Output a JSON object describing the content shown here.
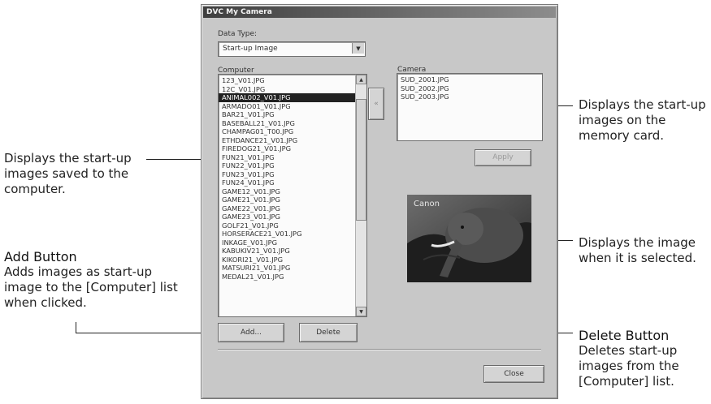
{
  "dialog": {
    "title": "DVC My Camera",
    "data_type_label": "Data Type:",
    "data_type_value": "Start-up Image",
    "computer_label": "Computer",
    "camera_label": "Camera",
    "computer_items": [
      "123_V01.JPG",
      "12C_V01.JPG",
      "ANIMAL002_V01.JPG",
      "ARMADO01_V01.JPG",
      "BAR21_V01.JPG",
      "BASEBALL21_V01.JPG",
      "CHAMPAG01_T00.JPG",
      "ETHDANCE21_V01.JPG",
      "FIREDOG21_V01.JPG",
      "FUN21_V01.JPG",
      "FUN22_V01.JPG",
      "FUN23_V01.JPG",
      "FUN24_V01.JPG",
      "GAME12_V01.JPG",
      "GAME21_V01.JPG",
      "GAME22_V01.JPG",
      "GAME23_V01.JPG",
      "GOLF21_V01.JPG",
      "HORSERACE21_V01.JPG",
      "INKAGE_V01.JPG",
      "KABUKIV21_V01.JPG",
      "KIKORI21_V01.JPG",
      "MATSURI21_V01.JPG",
      "MEDAL21_V01.JPG"
    ],
    "selected_index": 2,
    "camera_items": [
      "SUD_2001.JPG",
      "SUD_2002.JPG",
      "SUD_2003.JPG"
    ],
    "transfer_arrow": "«",
    "apply_label": "Apply",
    "add_label": "Add...",
    "delete_label": "Delete",
    "close_label": "Close",
    "preview_text": "Canon"
  },
  "callouts": {
    "camera_list": "Displays the start-up images on the memory card.",
    "computer_list": "Displays the start-up images saved to the computer.",
    "add_title": "Add Button",
    "add_body": "Adds images as start-up image to the [Computer] list when clicked.",
    "preview": "Displays the image when it is selected.",
    "delete_title": "Delete Button",
    "delete_body": "Deletes start-up images from the [Computer] list."
  }
}
